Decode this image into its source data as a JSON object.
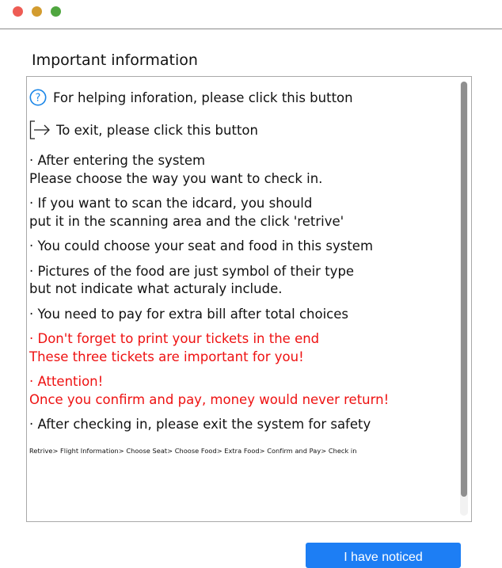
{
  "window": {
    "controls": [
      "close",
      "minimize",
      "maximize"
    ]
  },
  "heading": "Important information",
  "panel": {
    "help_line": "For helping inforation, please click this button",
    "exit_line": "To exit, please click this button",
    "paragraphs": [
      {
        "line1": "· After entering the system",
        "line2": "Please choose the way you want to check in."
      },
      {
        "line1": "· If you want to scan the idcard, you should",
        "line2": "put it in the scanning area and the click 'retrive'"
      },
      {
        "line1": "· You could choose your seat and food in this system"
      },
      {
        "line1": "· Pictures of the food are just symbol of their type",
        "line2": "but not indicate what acturaly include."
      },
      {
        "line1": "· You need to pay for extra bill after total choices"
      },
      {
        "line1": "· Don't forget to print your tickets in the end",
        "line2": "These three tickets are important for you!"
      },
      {
        "line1": "· Attention!",
        "line2": "Once you confirm and pay, money would never return!"
      },
      {
        "line1": "· After checking in, please exit the system for safety"
      }
    ],
    "flow": "Retrive> Flight Information> Choose Seat> Choose Food> Extra Food> Confirm and Pay> Check in"
  },
  "buttons": {
    "noticed": "I have noticed"
  },
  "icons": {
    "help": "question-circle-icon",
    "exit": "exit-arrow-icon"
  },
  "colors": {
    "accent": "#1d7ef4",
    "warning_text": "#ee1111",
    "help_icon": "#1a86e8"
  }
}
